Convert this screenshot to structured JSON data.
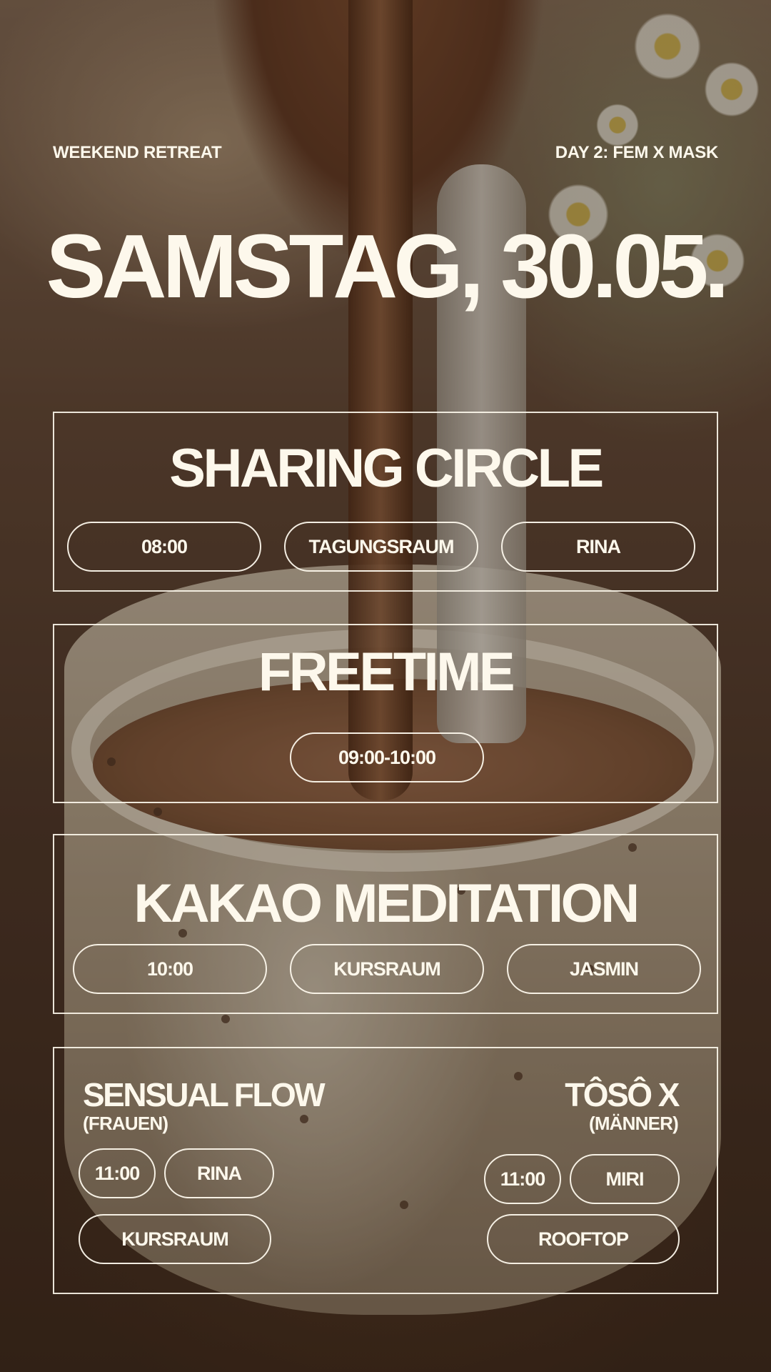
{
  "header": {
    "left_label": "WEEKEND RETREAT",
    "right_label": "DAY 2: FEM X MASK"
  },
  "date": "SAMSTAG, 30.05.",
  "sessions": [
    {
      "title": "SHARING CIRCLE",
      "time": "08:00",
      "room": "TAGUNGSRAUM",
      "host": "RINA"
    },
    {
      "title": "FREETIME",
      "time": "09:00-10:00"
    },
    {
      "title": "KAKAO MEDITATION",
      "time": "10:00",
      "room": "KURSRAUM",
      "host": "JASMIN"
    }
  ],
  "split_session": {
    "left": {
      "title": "SENSUAL FLOW",
      "note": "(FRAUEN)",
      "time": "11:00",
      "host": "RINA",
      "room": "KURSRAUM"
    },
    "right": {
      "title": "TÔSÔ X",
      "note": "(MÄNNER)",
      "time": "11:00",
      "host": "MIRI",
      "room": "ROOFTOP"
    }
  },
  "colors": {
    "text": "#fdf8ec",
    "outline": "#fdf8ec"
  }
}
